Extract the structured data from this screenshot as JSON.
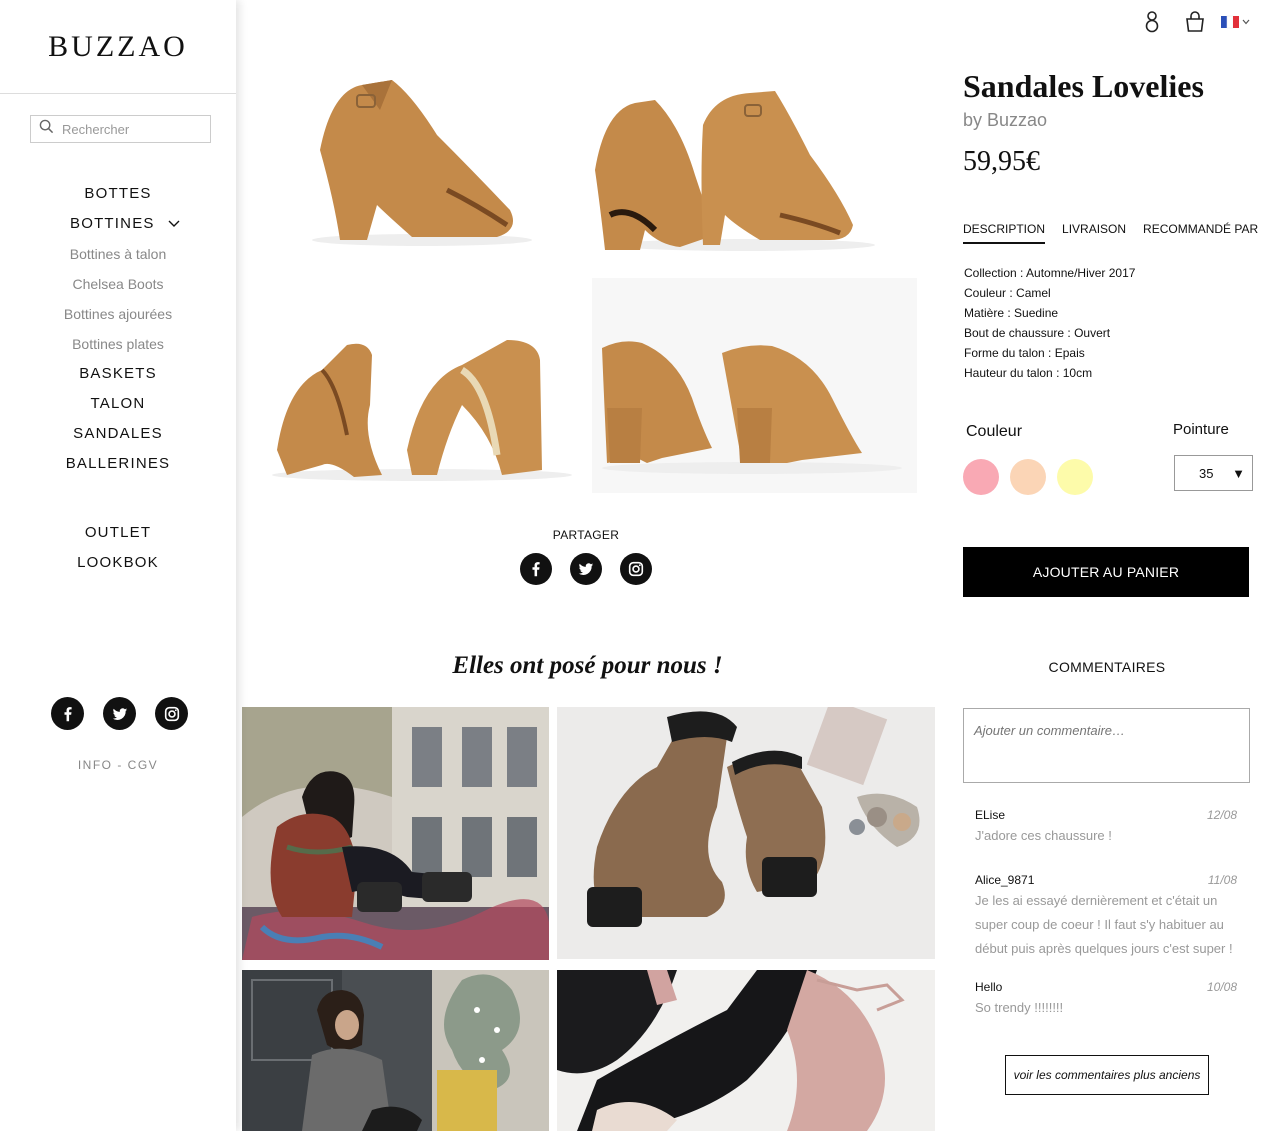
{
  "brand": {
    "logo": "BUZZAO"
  },
  "search": {
    "placeholder": "Rechercher"
  },
  "nav": {
    "items": [
      {
        "label": "BOTTES"
      },
      {
        "label": "BOTTINES"
      },
      {
        "label": "Bottines à talon"
      },
      {
        "label": "Chelsea Boots"
      },
      {
        "label": "Bottines ajourées"
      },
      {
        "label": "Bottines plates"
      },
      {
        "label": "BASKETS"
      },
      {
        "label": "TALON"
      },
      {
        "label": "SANDALES"
      },
      {
        "label": "BALLERINES"
      }
    ],
    "secondary": [
      {
        "label": "OUTLET"
      },
      {
        "label": "LOOKBOK"
      }
    ],
    "footer": "INFO - CGV"
  },
  "product": {
    "title": "Sandales Lovelies",
    "brand": "by Buzzao",
    "price": "59,95€",
    "tabs": [
      "DESCRIPTION",
      "LIVRAISON",
      "RECOMMANDÉ PAR"
    ],
    "specs": [
      {
        "key": "Collection",
        "value": "Automne/Hiver 2017"
      },
      {
        "key": "Couleur",
        "value": "Camel"
      },
      {
        "key": "Matière",
        "value": "Suedine"
      },
      {
        "key": "Bout de chaussure",
        "value": "Ouvert"
      },
      {
        "key": "Forme du talon",
        "value": "Epais"
      },
      {
        "key": "Hauteur du talon",
        "value": "10cm"
      }
    ],
    "color_label": "Couleur",
    "size_label": "Pointure",
    "swatches": [
      "#f9a9b4",
      "#fbd5b6",
      "#fdfbaa"
    ],
    "size_value": "35",
    "add_to_cart": "AJOUTER AU PANIER"
  },
  "share": {
    "label": "PARTAGER"
  },
  "posed": {
    "title": "Elles ont posé pour nous !"
  },
  "comments": {
    "title": "COMMENTAIRES",
    "placeholder": "Ajouter un commentaire…",
    "items": [
      {
        "user": "ELise",
        "date": "12/08",
        "text": "J'adore ces chaussure !"
      },
      {
        "user": "Alice_9871",
        "date": "11/08",
        "text": "Je les ai essayé dernièrement et c'était un super coup de coeur ! Il faut s'y habituer au début puis après quelques jours c'est super !"
      },
      {
        "user": "Hello",
        "date": "10/08",
        "text": "So trendy !!!!!!!!"
      }
    ],
    "older_button": "voir les commentaires plus anciens"
  },
  "colors": {
    "camel": "#c48a4a",
    "camel_dark": "#a06a32",
    "black": "#000000"
  }
}
